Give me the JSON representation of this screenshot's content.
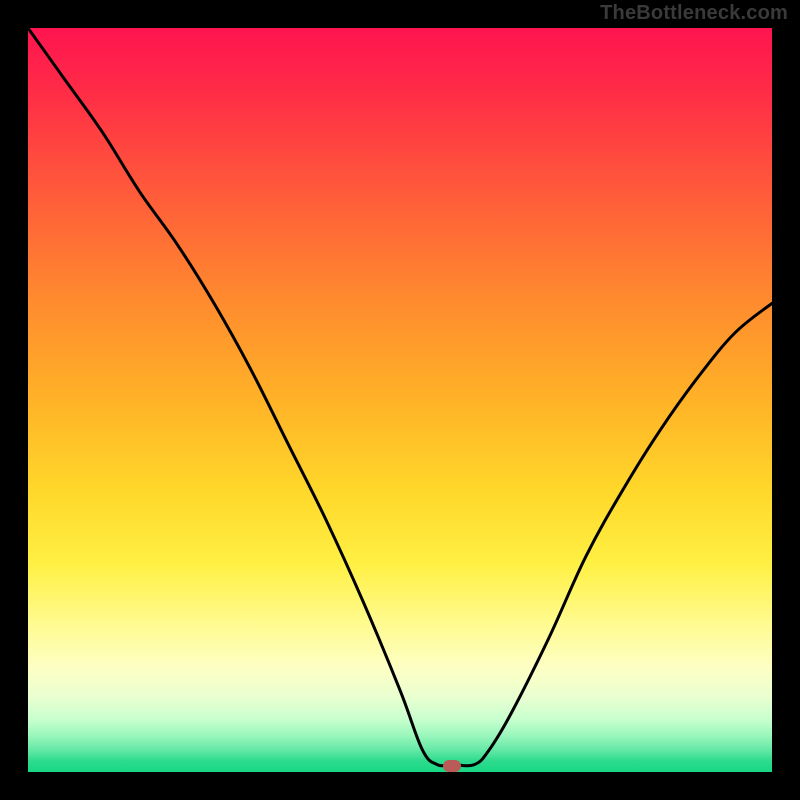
{
  "attribution": "TheBottleneck.com",
  "colors": {
    "page_bg": "#000000",
    "curve": "#000000",
    "marker": "#bb5b57",
    "gradient_top": "#ff1450",
    "gradient_bottom": "#17d884"
  },
  "chart_data": {
    "type": "line",
    "title": "",
    "xlabel": "",
    "ylabel": "",
    "xlim": [
      0,
      100
    ],
    "ylim": [
      0,
      100
    ],
    "grid": false,
    "axes_visible": false,
    "legend": false,
    "series": [
      {
        "name": "bottleneck-curve",
        "x": [
          0,
          5,
          10,
          15,
          20,
          25,
          30,
          35,
          40,
          45,
          50,
          53,
          55,
          57,
          60,
          62,
          65,
          70,
          75,
          80,
          85,
          90,
          95,
          100
        ],
        "y": [
          100,
          93,
          86,
          78,
          71,
          63,
          54,
          44,
          34,
          23,
          11,
          3,
          1,
          1,
          1,
          3,
          8,
          18,
          29,
          38,
          46,
          53,
          59,
          63
        ]
      }
    ],
    "annotations": [
      {
        "name": "optimal-marker",
        "x": 57,
        "y": 0.8,
        "shape": "pill",
        "color": "#bb5b57"
      }
    ],
    "background_gradient": {
      "direction": "vertical",
      "stops": [
        {
          "pct": 0,
          "color": "#ff1450"
        },
        {
          "pct": 22,
          "color": "#ff5a3a"
        },
        {
          "pct": 50,
          "color": "#ffb227"
        },
        {
          "pct": 72,
          "color": "#fff043"
        },
        {
          "pct": 86,
          "color": "#fdffc4"
        },
        {
          "pct": 95,
          "color": "#9cf7bd"
        },
        {
          "pct": 100,
          "color": "#17d884"
        }
      ]
    }
  }
}
